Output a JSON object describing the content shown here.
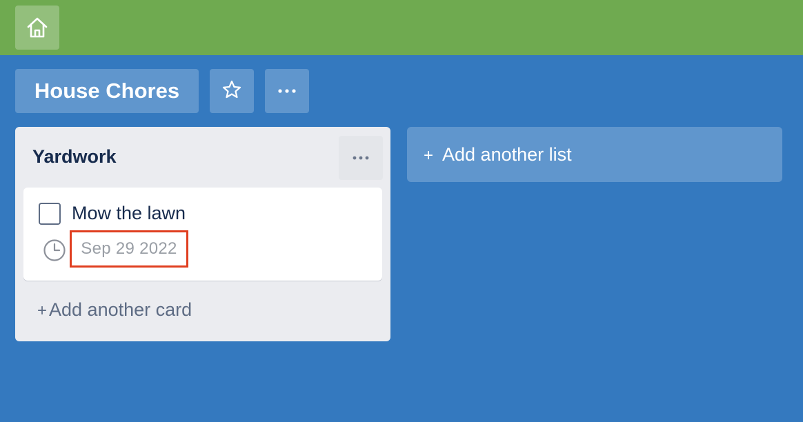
{
  "topbar": {
    "home_icon": "home-icon",
    "bg_color": "#6faa50"
  },
  "board": {
    "title": "House Chores",
    "star_icon": "star-icon",
    "more_icon": "ellipsis-icon",
    "bg_color": "#3479bf"
  },
  "lists": [
    {
      "title": "Yardwork",
      "menu_icon": "ellipsis-icon",
      "cards": [
        {
          "title": "Mow the lawn",
          "checked": false,
          "due_icon": "clock-icon",
          "due_date": "Sep 29 2022",
          "highlight_color": "#e03e1f"
        }
      ],
      "add_card_plus": "+",
      "add_card_label": "Add another card"
    }
  ],
  "add_list": {
    "plus": "+",
    "label": "Add another list"
  }
}
